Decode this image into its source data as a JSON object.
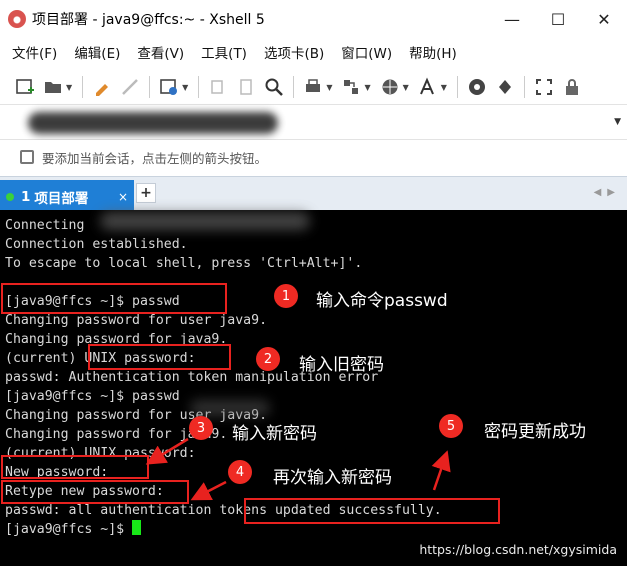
{
  "window": {
    "title": "项目部署 - java9@ffcs:~ - Xshell 5",
    "minimize": "—",
    "maximize": "☐",
    "close": "✕"
  },
  "menu": [
    "文件(F)",
    "编辑(E)",
    "查看(V)",
    "工具(T)",
    "选项卡(B)",
    "窗口(W)",
    "帮助(H)"
  ],
  "hint": "要添加当前会话，点击左侧的箭头按钮。",
  "tab": {
    "number": "1",
    "label": "项目部署",
    "close": "×",
    "add": "+"
  },
  "terminal": {
    "lines": [
      "Connecting",
      "Connection established.",
      "To escape to local shell, press 'Ctrl+Alt+]'.",
      "",
      "[java9@ffcs ~]$ passwd",
      "Changing password for user java9.",
      "Changing password for java9.",
      "(current) UNIX password:",
      "passwd: Authentication token manipulation error",
      "[java9@ffcs ~]$ passwd",
      "Changing password for user java9.",
      "Changing password for java9.",
      "(current) UNIX password:",
      "New password:",
      "Retype new password:",
      "passwd: all authentication tokens updated successfully.",
      "[java9@ffcs ~]$ "
    ]
  },
  "annotations": [
    {
      "number": "1",
      "text": "输入命令passwd"
    },
    {
      "number": "2",
      "text": "输入旧密码"
    },
    {
      "number": "3",
      "text": "输入新密码"
    },
    {
      "number": "4",
      "text": "再次输入新密码"
    },
    {
      "number": "5",
      "text": "密码更新成功"
    }
  ],
  "watermark": "https://blog.csdn.net/xgysimida",
  "colors": {
    "terminal_bg": "#000000",
    "terminal_fg": "#d9d9d9",
    "annotation_red": "#e8221f",
    "tab_blue": "#1f7fd6",
    "cursor_green": "#18e818"
  }
}
